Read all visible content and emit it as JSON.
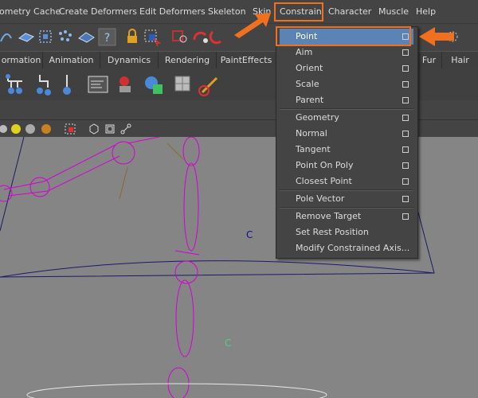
{
  "menubar": {
    "items": [
      "ometry Cache",
      "Create Deformers",
      "Edit Deformers",
      "Skeleton",
      "Skin",
      "Constrain",
      "Character",
      "Muscle",
      "Help"
    ]
  },
  "shelf_tabs": [
    "ormation",
    "Animation",
    "Dynamics",
    "Rendering",
    "PaintEffects",
    "Fur",
    "Hair"
  ],
  "constrain_menu": {
    "items": [
      "Point",
      "Aim",
      "Orient",
      "Scale",
      "Parent",
      "Geometry",
      "Normal",
      "Tangent",
      "Point On Poly",
      "Closest Point",
      "Pole Vector",
      "Remove Target",
      "Set Rest Position",
      "Modify Constrained Axis..."
    ],
    "active_item": "Point"
  },
  "viewport": {
    "labels": [
      "C",
      "C"
    ]
  },
  "colors": {
    "highlight": "#f07020",
    "selected_item": "#5b84b4",
    "joint": "#d400d4",
    "viewport_bg": "#858585"
  },
  "icons": [
    "curve-tool-icon",
    "snap-grid-icon",
    "snap-curve-icon",
    "snap-point-icon",
    "snap-view-icon",
    "help-icon",
    "lock-icon",
    "select-icon",
    "construction-history-icon",
    "render-icon",
    "ipr-icon",
    "magnet-icon"
  ]
}
